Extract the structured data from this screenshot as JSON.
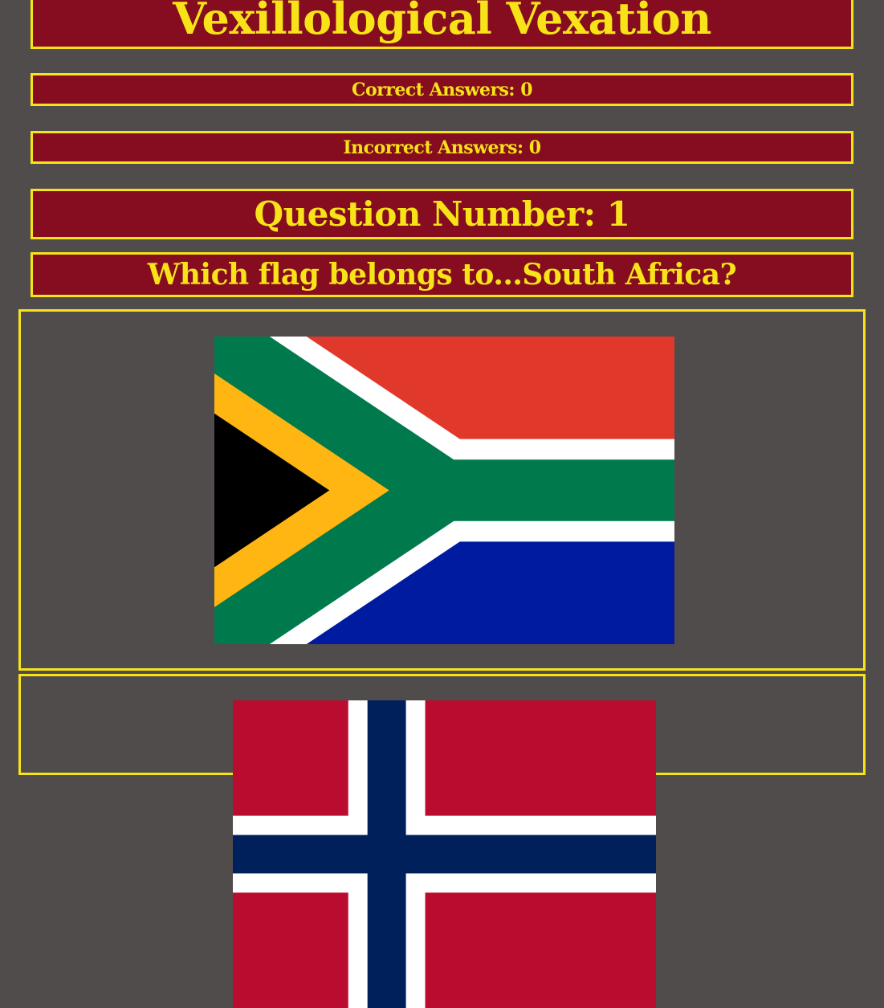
{
  "header": {
    "title": "Vexillological Vexation"
  },
  "score": {
    "correct_label": "Correct Answers: 0",
    "correct_value": 0,
    "incorrect_label": "Incorrect Answers: 0",
    "incorrect_value": 0
  },
  "question": {
    "number_label": "Question Number: 1",
    "number": 1,
    "prompt": "Which flag belongs to...South Africa?",
    "target_country": "South Africa"
  },
  "options": [
    {
      "flag": "south-africa-flag",
      "colors": {
        "red": "#e0392b",
        "white": "#ffffff",
        "green": "#007a4d",
        "blue": "#001aa0",
        "black": "#000000",
        "gold": "#ffb612"
      }
    },
    {
      "flag": "norway-flag",
      "colors": {
        "red": "#ba0c2f",
        "white": "#ffffff",
        "blue": "#00205b"
      }
    }
  ],
  "theme": {
    "background": "#514c4c",
    "banner": "#860d1f",
    "accent": "#f7e317"
  }
}
